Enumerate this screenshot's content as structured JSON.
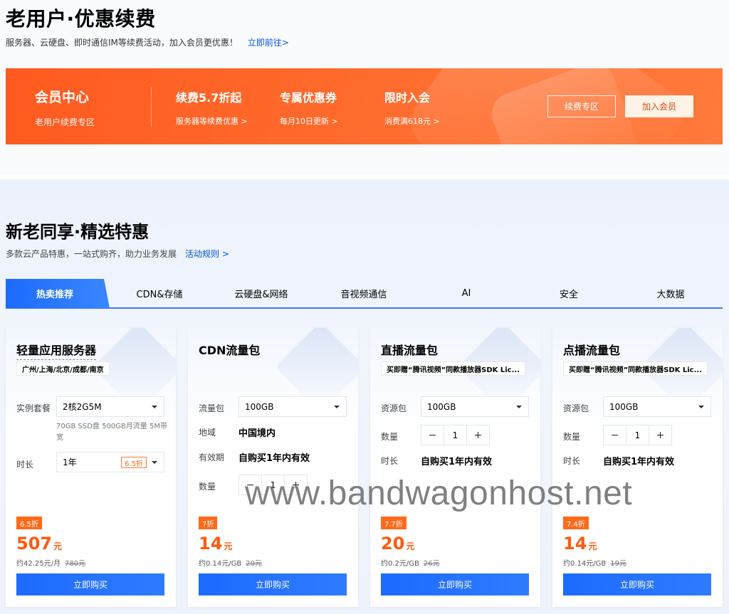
{
  "renew": {
    "title": "老用户·优惠续费",
    "subtitle": "服务器、云硬盘、即时通信IM等续费活动，加入会员更优惠！",
    "link": "立即前往>",
    "banner": {
      "main_title": "会员中心",
      "main_sub": "老用户续费专区",
      "items": [
        {
          "title": "续费5.7折起",
          "sub": "服务器等续费优惠 >"
        },
        {
          "title": "专属优惠券",
          "sub": "每月10日更新 >"
        },
        {
          "title": "限时入会",
          "sub": "消费满618元 >"
        }
      ],
      "btn_renew": "续费专区",
      "btn_join": "加入会员",
      "color": "#ff6a2b"
    }
  },
  "deals": {
    "title": "新老同享·精选特惠",
    "subtitle": "多款云产品特惠，一站式购齐，助力业务发展",
    "link": "活动规则 >",
    "tabs": [
      "热卖推荐",
      "CDN&存储",
      "云硬盘&网络",
      "音视频通信",
      "AI",
      "安全",
      "大数据"
    ],
    "active_tab": 0,
    "accent": "#1d6bff",
    "price_color": "#ff5a0f"
  },
  "cards": [
    {
      "title": "轻量应用服务器",
      "tag": "广州/上海/北京/成都/南京",
      "label_plan": "实例套餐",
      "plan": "2核2G5M",
      "spec": "70GB SSD盘 500GB月流量 5M带宽",
      "label_duration": "时长",
      "duration": "1年",
      "duration_badge": "6.5折",
      "discount": "6.5折",
      "price": "507",
      "unit": "元",
      "per": "约42.25元/月",
      "orig": "780元",
      "buy": "立即购买"
    },
    {
      "title": "CDN流量包",
      "label_pkg": "流量包",
      "pkg": "100GB",
      "label_region": "地域",
      "region": "中国境内",
      "label_valid": "有效期",
      "valid": "自购买1年内有效",
      "label_qty": "数量",
      "qty": "1",
      "minus": "−",
      "plus": "+",
      "discount": "7折",
      "price": "14",
      "unit": "元",
      "per": "约0.14元/GB",
      "orig": "20元",
      "buy": "立即购买"
    },
    {
      "title": "直播流量包",
      "tag": "买即赠“腾讯视频”同款播放器SDK Lic...",
      "label_pkg": "资源包",
      "pkg": "100GB",
      "label_qty": "数量",
      "qty": "1",
      "minus": "−",
      "plus": "+",
      "label_duration": "时长",
      "duration": "自购买1年内有效",
      "discount": "7.7折",
      "price": "20",
      "unit": "元",
      "per": "约0.2元/GB",
      "orig": "26元",
      "buy": "立即购买"
    },
    {
      "title": "点播流量包",
      "tag": "买即赠“腾讯视频”同款播放器SDK Lic...",
      "label_pkg": "资源包",
      "pkg": "100GB",
      "label_qty": "数量",
      "qty": "1",
      "minus": "−",
      "plus": "+",
      "label_duration": "时长",
      "duration": "自购买1年内有效",
      "discount": "7.4折",
      "price": "14",
      "unit": "元",
      "per": "约0.14元/GB",
      "orig": "19元",
      "buy": "立即购买"
    }
  ],
  "watermark": "www.bandwagonhost.net"
}
